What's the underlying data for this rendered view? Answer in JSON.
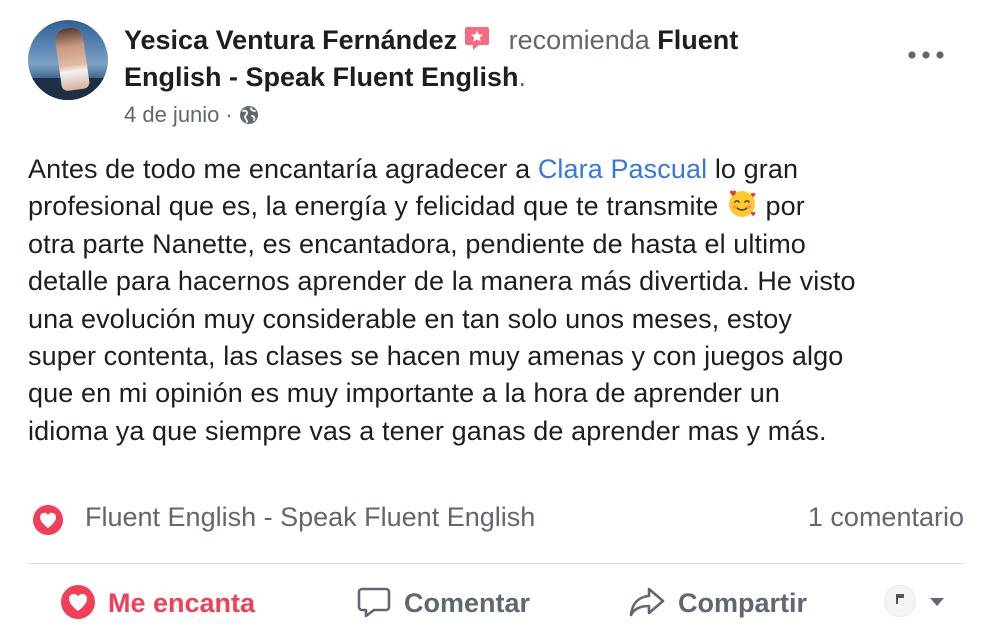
{
  "post": {
    "author": "Yesica Ventura Fernández",
    "recommends_word": "recomienda",
    "page_name_part1": "Fluent",
    "page_name_part2": "English - Speak Fluent English",
    "period": ".",
    "date": "4 de junio",
    "date_separator": "·",
    "privacy_icon": "globe-icon",
    "badge_icon": "star-badge-icon",
    "body_lines": [
      {
        "before": "Antes de todo me encantaría agradecer a ",
        "mention": "Clara Pascual",
        "after": " lo gran"
      },
      {
        "before": "profesional que es, la energía y felicidad que te transmite ",
        "emoji": "smiling-face-with-hearts",
        "after": " por"
      },
      {
        "text": "otra parte Nanette, es encantadora, pendiente de hasta el ultimo"
      },
      {
        "text": "detalle para hacernos aprender de la manera más divertida. He visto"
      },
      {
        "text": "una evolución muy considerable en tan solo unos meses, estoy"
      },
      {
        "text": "super contenta, las clases se hacen muy amenas y con juegos algo"
      },
      {
        "text": "que en mi opinión es muy importante a la hora de aprender un"
      },
      {
        "text": "idioma ya que siempre vas a tener ganas de aprender mas y más."
      }
    ]
  },
  "reactions": {
    "icon": "heart-reaction-icon",
    "label": "Fluent English - Speak Fluent English",
    "comments": "1 comentario"
  },
  "actions": {
    "love_label": "Me encanta",
    "comment_label": "Comentar",
    "share_label": "Compartir"
  },
  "colors": {
    "love_red": "#f33e58",
    "mention_blue": "#3578e5",
    "secondary_text": "#606770",
    "divider": "#dadde1"
  }
}
